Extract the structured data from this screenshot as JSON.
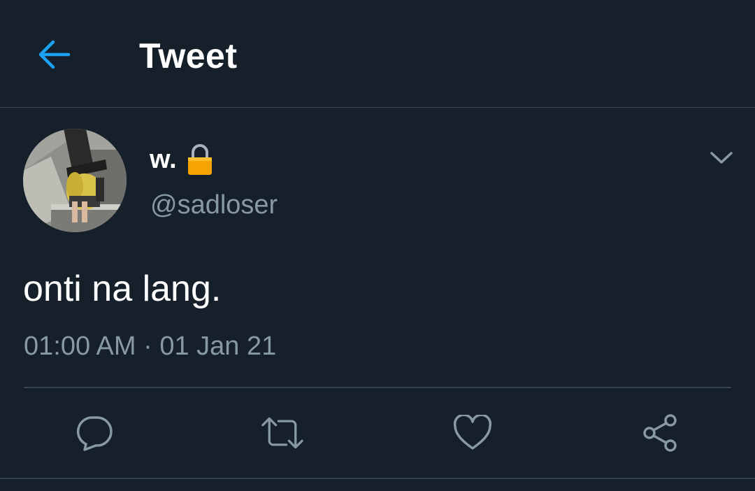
{
  "header": {
    "title": "Tweet",
    "back_icon": "arrow-left-icon"
  },
  "tweet": {
    "author": {
      "display_name": "w.",
      "handle": "@sadloser",
      "protected_icon": "lock-icon",
      "avatar": "profile-photo"
    },
    "text": "onti na lang.",
    "timestamp": "01:00 AM · 01 Jan 21"
  },
  "actions": [
    {
      "name": "reply",
      "icon": "reply-icon"
    },
    {
      "name": "retweet",
      "icon": "retweet-icon"
    },
    {
      "name": "like",
      "icon": "heart-icon"
    },
    {
      "name": "share",
      "icon": "share-icon"
    }
  ],
  "colors": {
    "background": "#15202b",
    "accent": "#1da1f2",
    "secondary_text": "#8899a6",
    "divider": "#38444d",
    "lock": "#f7a400"
  }
}
